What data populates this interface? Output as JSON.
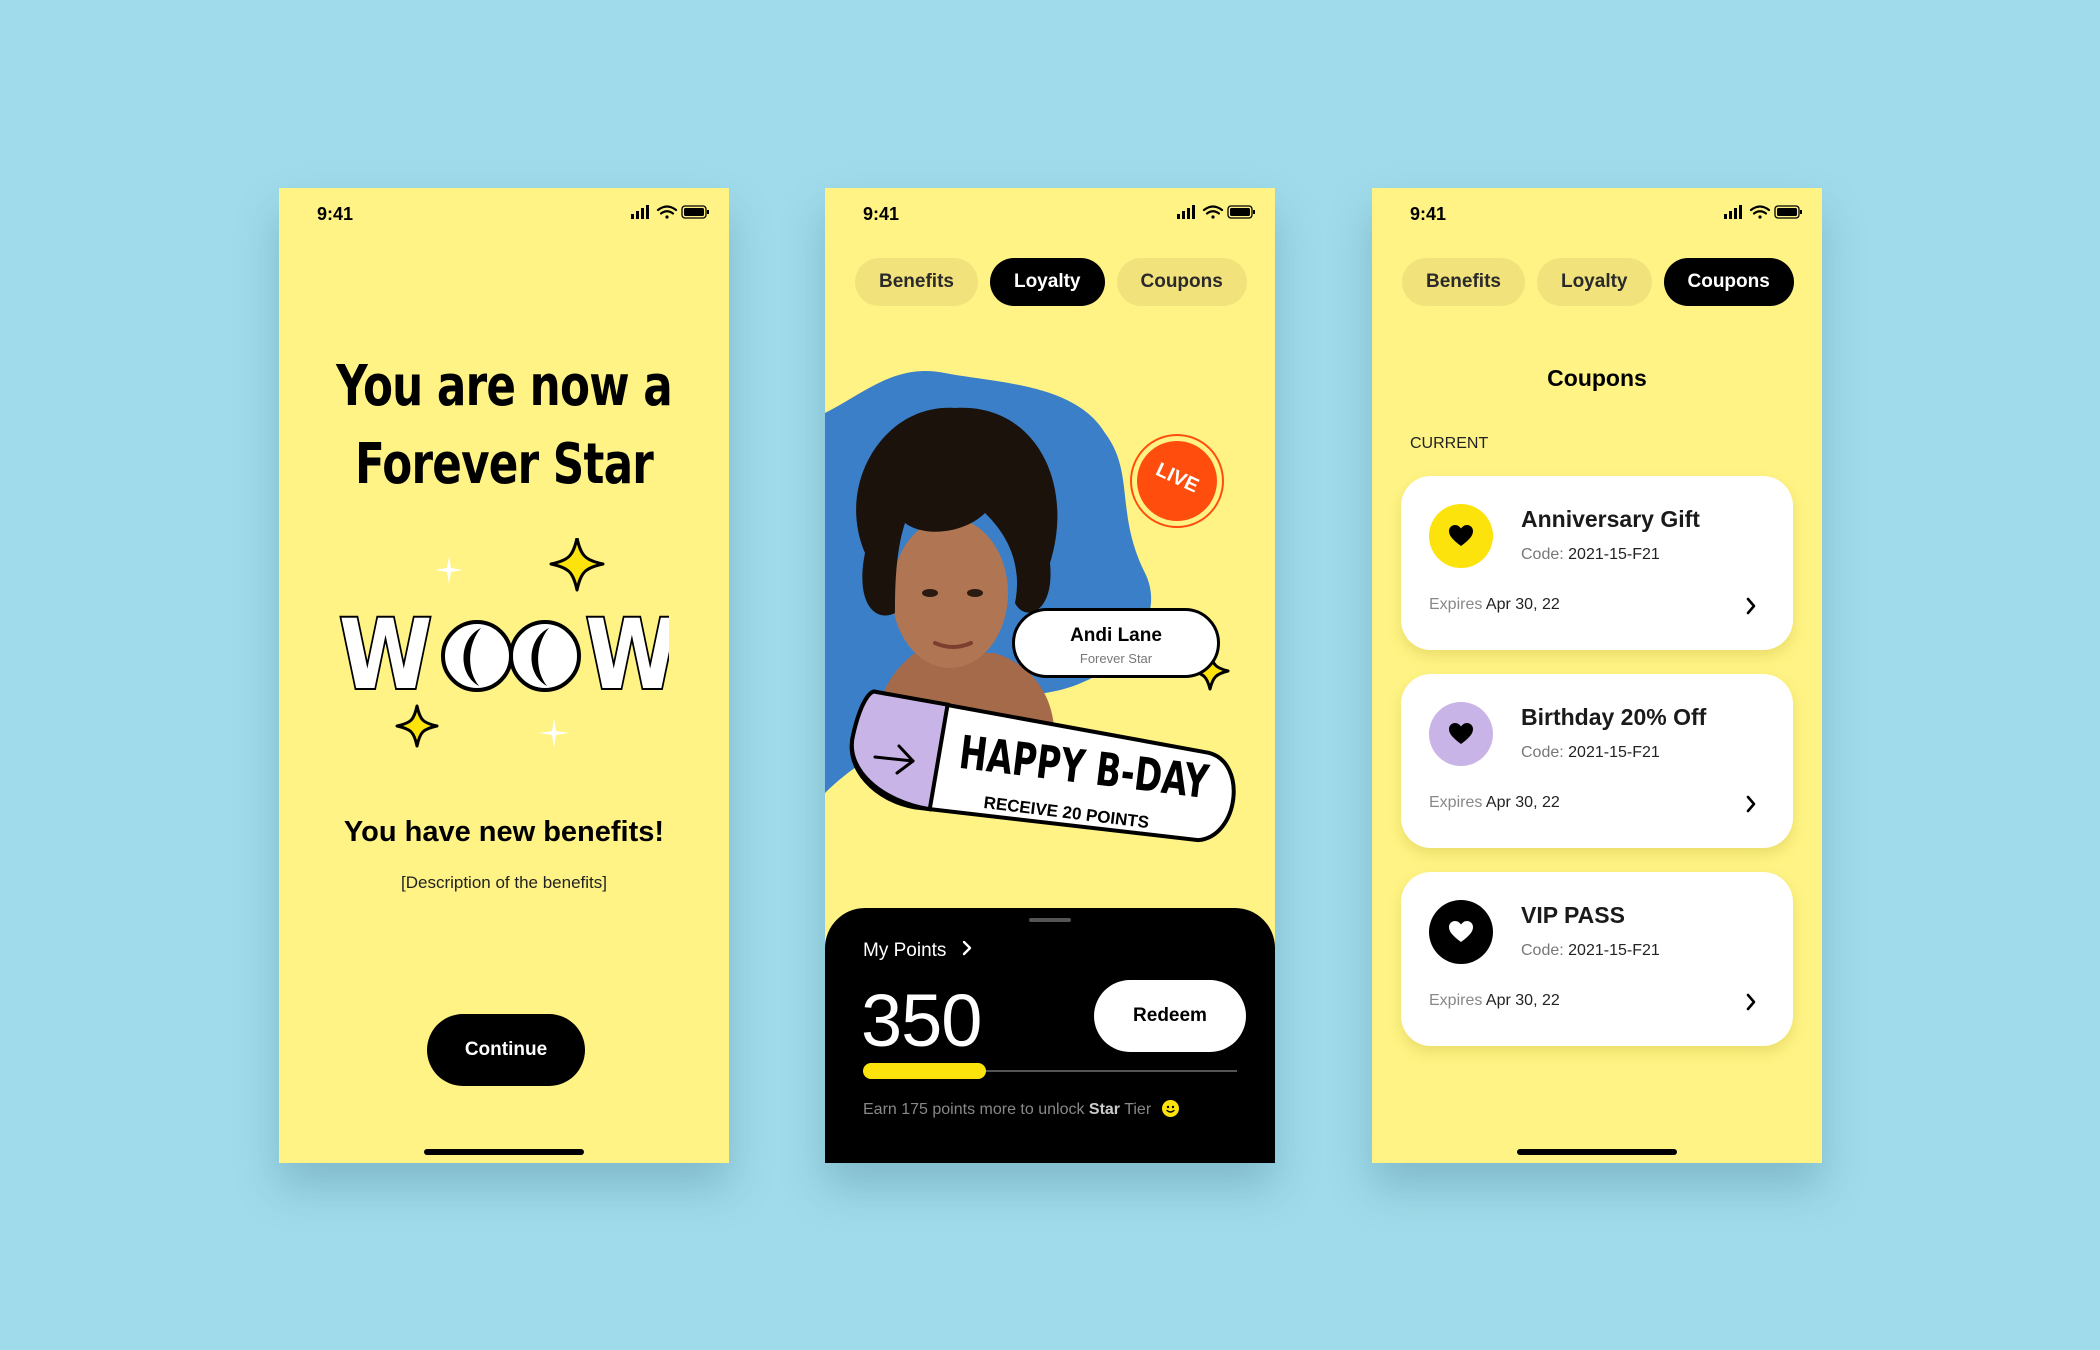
{
  "status_time": "9:41",
  "onboarding": {
    "headline_line1": "You are now a",
    "headline_line2": "Forever Star",
    "woow_text": "WOOW",
    "subheading": "You have new benefits!",
    "description": "[Description of the benefits]",
    "continue_label": "Continue"
  },
  "tabs": [
    "Benefits",
    "Loyalty",
    "Coupons"
  ],
  "loyalty": {
    "active_tab": "Loyalty",
    "profile_name": "Andi Lane",
    "profile_tier": "Forever Star",
    "live_badge": "LIVE",
    "banner_title": "HAPPY B-DAY",
    "banner_subtitle": "RECEIVE 20 POINTS",
    "my_points_label": "My Points",
    "points_value": "350",
    "redeem_label": "Redeem",
    "progress_fraction": 0.33,
    "earn_prefix": "Earn 175 points more to unlock ",
    "earn_tier": "Star",
    "earn_suffix": " Tier"
  },
  "coupons_screen": {
    "active_tab": "Coupons",
    "title": "Coupons",
    "section_label": "CURRENT",
    "code_label": "Code:",
    "expires_label": "Expires",
    "items": [
      {
        "title": "Anniversary Gift",
        "code": "2021-15-F21",
        "expires": "Apr 30, 22",
        "icon_color": "#fde30c",
        "heart_color": "#000000"
      },
      {
        "title": "Birthday 20% Off",
        "code": "2021-15-F21",
        "expires": "Apr 30, 22",
        "icon_color": "#c8b4e6",
        "heart_color": "#000000"
      },
      {
        "title": "VIP PASS",
        "code": "2021-15-F21",
        "expires": "Apr 30, 22",
        "icon_color": "#000000",
        "heart_color": "#ffffff"
      }
    ]
  },
  "colors": {
    "background": "#9fdbea",
    "phone_bg": "#fef384",
    "accent_yellow": "#fde30c",
    "live_orange": "#ff4d0d",
    "lavender": "#c8b4e6"
  }
}
